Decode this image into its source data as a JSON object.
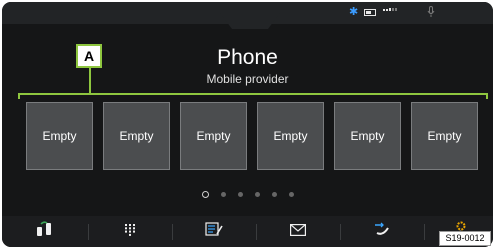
{
  "header": {
    "title": "Phone",
    "subtitle": "Mobile provider"
  },
  "status_icons": [
    "bluetooth-icon",
    "battery-icon",
    "signal-strength-icon",
    "microphone-icon"
  ],
  "callout": {
    "label": "A",
    "color": "#8ec63f"
  },
  "presets": [
    {
      "label": "Empty"
    },
    {
      "label": "Empty"
    },
    {
      "label": "Empty"
    },
    {
      "label": "Empty"
    },
    {
      "label": "Empty"
    },
    {
      "label": "Empty"
    }
  ],
  "pagination": {
    "total_pages": 6,
    "current_page": 1
  },
  "nav_bar": [
    {
      "name": "phone-transfer-icon"
    },
    {
      "name": "keypad-icon"
    },
    {
      "name": "contacts-icon"
    },
    {
      "name": "messages-icon"
    },
    {
      "name": "call-list-icon"
    },
    {
      "name": "settings-icon"
    }
  ],
  "figure_code": "S19-0012",
  "colors": {
    "screen_bg": "#151617",
    "tile_bg": "#4b4d4f",
    "bluetooth": "#3b9cff"
  }
}
